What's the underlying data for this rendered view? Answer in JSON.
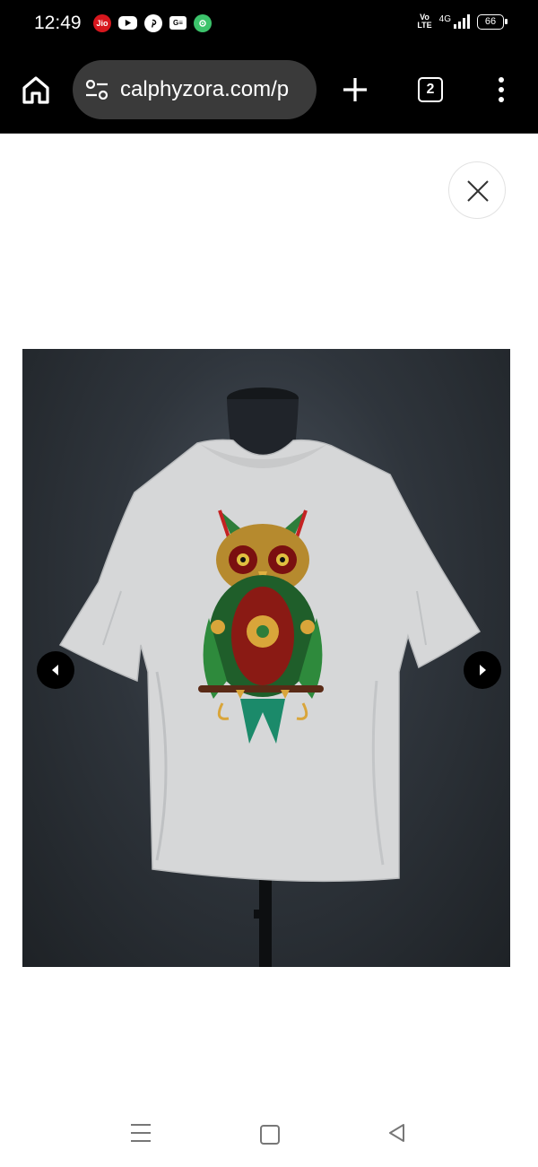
{
  "status_bar": {
    "time": "12:49",
    "icons": [
      "jio-icon",
      "youtube-icon",
      "pinterest-icon",
      "gmail-icon",
      "chrome-icon"
    ],
    "jio_label": "Jio",
    "ge_label": "G≡",
    "volte_label": "Vo\nLTE",
    "network": "4G",
    "battery": "66"
  },
  "browser": {
    "url": "calphyzora.com/p",
    "tab_count": "2"
  },
  "colors": {
    "toolbar_bg": "#000000",
    "url_box_bg": "#3a3a3a",
    "page_bg": "#ffffff",
    "backdrop": "#2f353c",
    "tshirt": "#d9dadb"
  },
  "product": {
    "image_alt": "Grey oversized t-shirt with owl print on mannequin",
    "gallery_prev_icon": "chevron-left-icon",
    "gallery_next_icon": "chevron-right-icon",
    "close_icon": "close-icon"
  },
  "nav_bar": {
    "icons": [
      "recent-apps-icon",
      "home-icon",
      "back-icon"
    ]
  }
}
